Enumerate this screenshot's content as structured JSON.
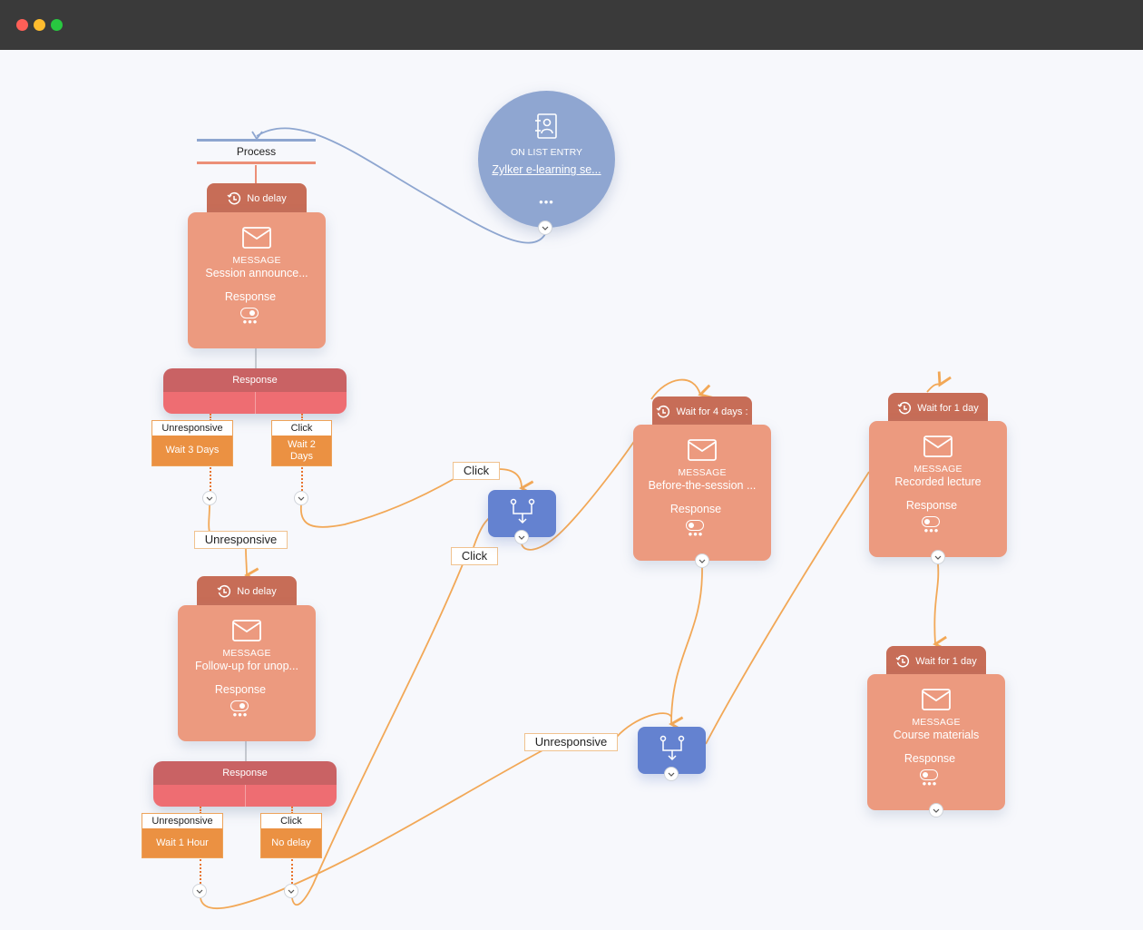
{
  "window": {
    "controls": {
      "close_color": "#fe5f57",
      "minimize_color": "#febc2e",
      "maximize_color": "#28c840"
    }
  },
  "colors": {
    "canvas_bg": "#f7f8fc",
    "message_card": "#ec9a7f",
    "message_tab": "#c76d57",
    "response_bar_top": "#c96264",
    "response_bar_bottom": "#ee6d72",
    "branch_body": "#eb9142",
    "decision": "#6482d0",
    "trigger": "#8fa6d1",
    "wire_orange": "#f2a857",
    "wire_blue": "#8ea6d0"
  },
  "trigger": {
    "icon": "contact-book-icon",
    "kind": "ON LIST ENTRY",
    "name": "Zylker e-learning se...",
    "more": "•••"
  },
  "process": {
    "label": "Process"
  },
  "messages": [
    {
      "id": "m1",
      "delay": "No delay",
      "kind": "MESSAGE",
      "title": "Session announce...",
      "response_label": "Response",
      "response_on": true,
      "more": "•••"
    },
    {
      "id": "m2",
      "delay": "No delay",
      "kind": "MESSAGE",
      "title": "Follow-up for unop...",
      "response_label": "Response",
      "response_on": true,
      "more": "•••"
    },
    {
      "id": "m3",
      "delay": "Wait for 4 days :",
      "kind": "MESSAGE",
      "title": "Before-the-session ...",
      "response_label": "Response",
      "response_on": false,
      "more": "•••"
    },
    {
      "id": "m4",
      "delay": "Wait for 1 day",
      "kind": "MESSAGE",
      "title": "Recorded lecture",
      "response_label": "Response",
      "response_on": false,
      "more": "•••"
    },
    {
      "id": "m5",
      "delay": "Wait for 1 day",
      "kind": "MESSAGE",
      "title": "Course materials",
      "response_label": "Response",
      "response_on": false,
      "more": "•••"
    }
  ],
  "response_bars": [
    {
      "label": "Response"
    },
    {
      "label": "Response"
    }
  ],
  "branches": [
    {
      "head": "Unresponsive",
      "body": "Wait 3 Days"
    },
    {
      "head": "Click",
      "body": "Wait 2 Days"
    },
    {
      "head": "Unresponsive",
      "body": "Wait 1 Hour"
    },
    {
      "head": "Click",
      "body": "No delay"
    }
  ],
  "path_labels": [
    {
      "text": "Unresponsive"
    },
    {
      "text": "Click"
    },
    {
      "text": "Click"
    },
    {
      "text": "Unresponsive"
    }
  ]
}
